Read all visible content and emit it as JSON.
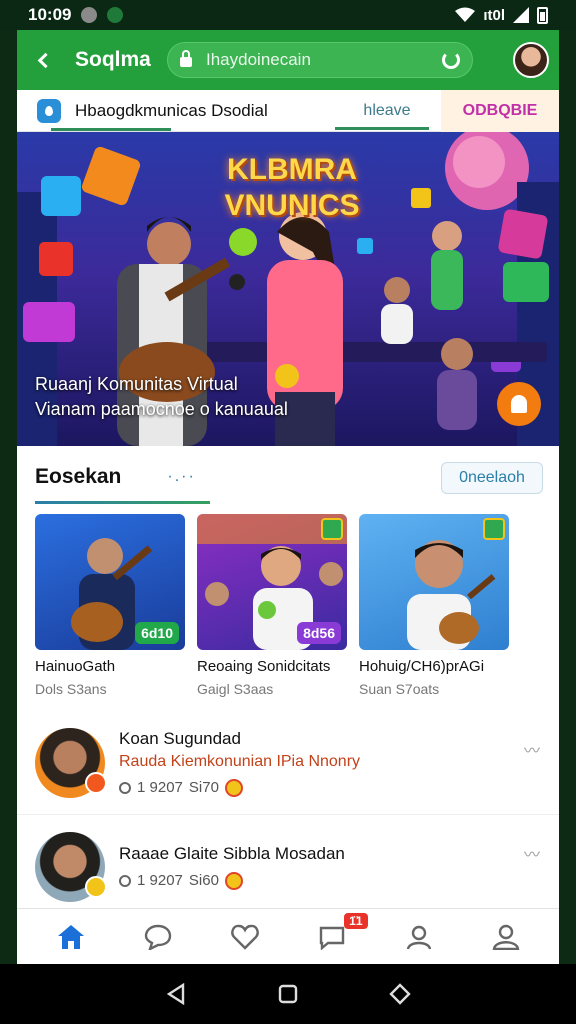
{
  "status_bar": {
    "time": "10:09",
    "signal_text": "ıt0l"
  },
  "top_bar": {
    "title": "Soqlma",
    "url": "Ihaydoinecain"
  },
  "sub_bar": {
    "title": "Hbaogdkmunicas Dsodial",
    "tab_active": "hleave",
    "tab_highlight": "ODBQBIE"
  },
  "hero": {
    "banner_title_line1": "KLBMRA",
    "banner_title_line2": "VNUNICS",
    "caption_line1": "Ruaanj Komunitas Virtual",
    "caption_line2": "Vianam paamocnoe o kanuaual"
  },
  "section": {
    "title": "Eosekan",
    "dots": "·.··",
    "button": "0neelaoh"
  },
  "cards": [
    {
      "title": "HainuoGath",
      "sub": "Dols S3ans",
      "badge": "6d10"
    },
    {
      "title": "Reoaing Sonidcitats",
      "sub": "Gaigl S3aas",
      "badge": "8d56"
    },
    {
      "title": "Hohuig/CH6)prAGi",
      "sub": "Suan S7oats",
      "badge": ""
    }
  ],
  "list": [
    {
      "title": "Koan Sugundad",
      "sub": "Rauda Kiemkonunian IPia Nnonry",
      "meta_count": "1 9207",
      "meta_size": "Si70"
    },
    {
      "title": "Raaae Glaite Sibbla Mosadan",
      "sub": "",
      "meta_count": "1 9207",
      "meta_size": "Si60"
    }
  ],
  "bottom_nav": {
    "items": [
      "home-icon",
      "chat-bubble-icon",
      "heart-icon",
      "message-icon",
      "person-icon",
      "profile-icon"
    ],
    "message_badge": "1̈1"
  },
  "colors": {
    "brand": "#23a03b",
    "accent": "#c230a8",
    "link": "#2a7fa8"
  }
}
